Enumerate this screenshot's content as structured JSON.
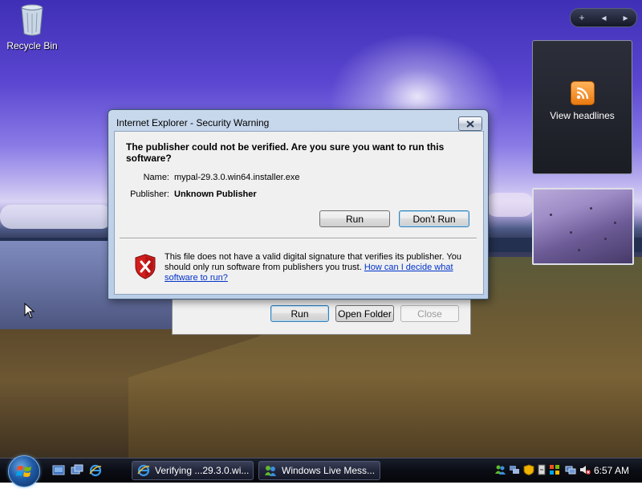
{
  "desktop": {
    "icons": [
      {
        "label": "Recycle Bin"
      }
    ]
  },
  "sidebar": {
    "controls": [
      "+",
      "◂",
      "▸"
    ],
    "feed_gadget": {
      "label": "View headlines",
      "icon": "rss-icon"
    }
  },
  "security_dialog": {
    "title": "Internet Explorer - Security Warning",
    "question": "The publisher could not be verified.  Are you sure you want to run this software?",
    "name_label": "Name:",
    "name_value": "mypal-29.3.0.win64.installer.exe",
    "publisher_label": "Publisher:",
    "publisher_value": "Unknown Publisher",
    "run_button": "Run",
    "dont_run_button": "Don't Run",
    "info_text": "This file does not have a valid digital signature that verifies its publisher. You should only run software from publishers you trust.",
    "info_link": "How can I decide what software to run?"
  },
  "download_dialog": {
    "run_button": "Run",
    "open_folder_button": "Open Folder",
    "close_button": "Close"
  },
  "taskbar": {
    "tasks": [
      {
        "label": "Verifying ...29.3.0.wi...",
        "icon": "ie-icon"
      },
      {
        "label": "Windows Live Mess...",
        "icon": "messenger-icon"
      }
    ],
    "clock": "6:57 AM"
  },
  "colors": {
    "dialog_frame": "#b9cde6",
    "link": "#0033cc",
    "taskbar": "#0b0d14"
  }
}
